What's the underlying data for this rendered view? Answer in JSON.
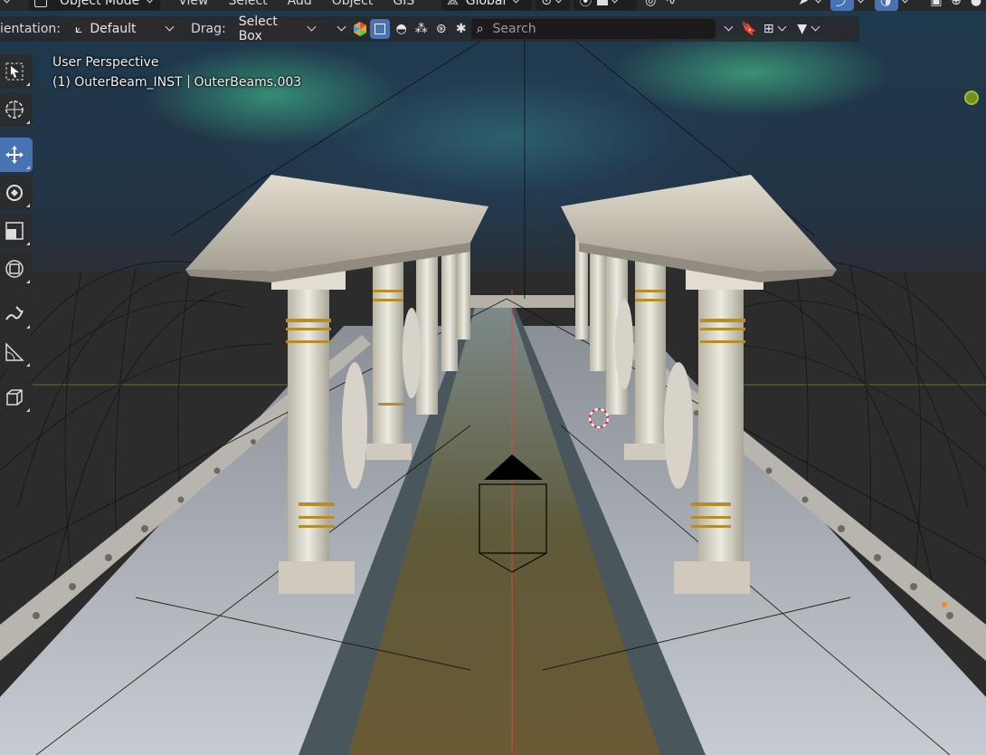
{
  "header_top": {
    "mode": "Object Mode",
    "menus": [
      "View",
      "Select",
      "Add",
      "Object",
      "GIS"
    ],
    "transform_orientation": "Global"
  },
  "header_tool": {
    "orientation_label": "ientation:",
    "orientation_value": "Default",
    "drag_label": "Drag:",
    "drag_value": "Select Box",
    "search_placeholder": "Search"
  },
  "toolbar": {
    "tools": [
      "select-box",
      "cursor",
      "move",
      "rotate",
      "scale",
      "transform",
      "annotate",
      "measure",
      "add-cube"
    ],
    "active_tool": "move"
  },
  "viewport": {
    "view_name": "User Perspective",
    "object_info": "(1) OuterBeam_INST",
    "object_data": "OuterBeams.003"
  },
  "colors": {
    "header_bg": "#282828",
    "active_blue": "#4772b3",
    "gizmo_green": "#6f8f1f",
    "nebula_green": "#46d296"
  }
}
